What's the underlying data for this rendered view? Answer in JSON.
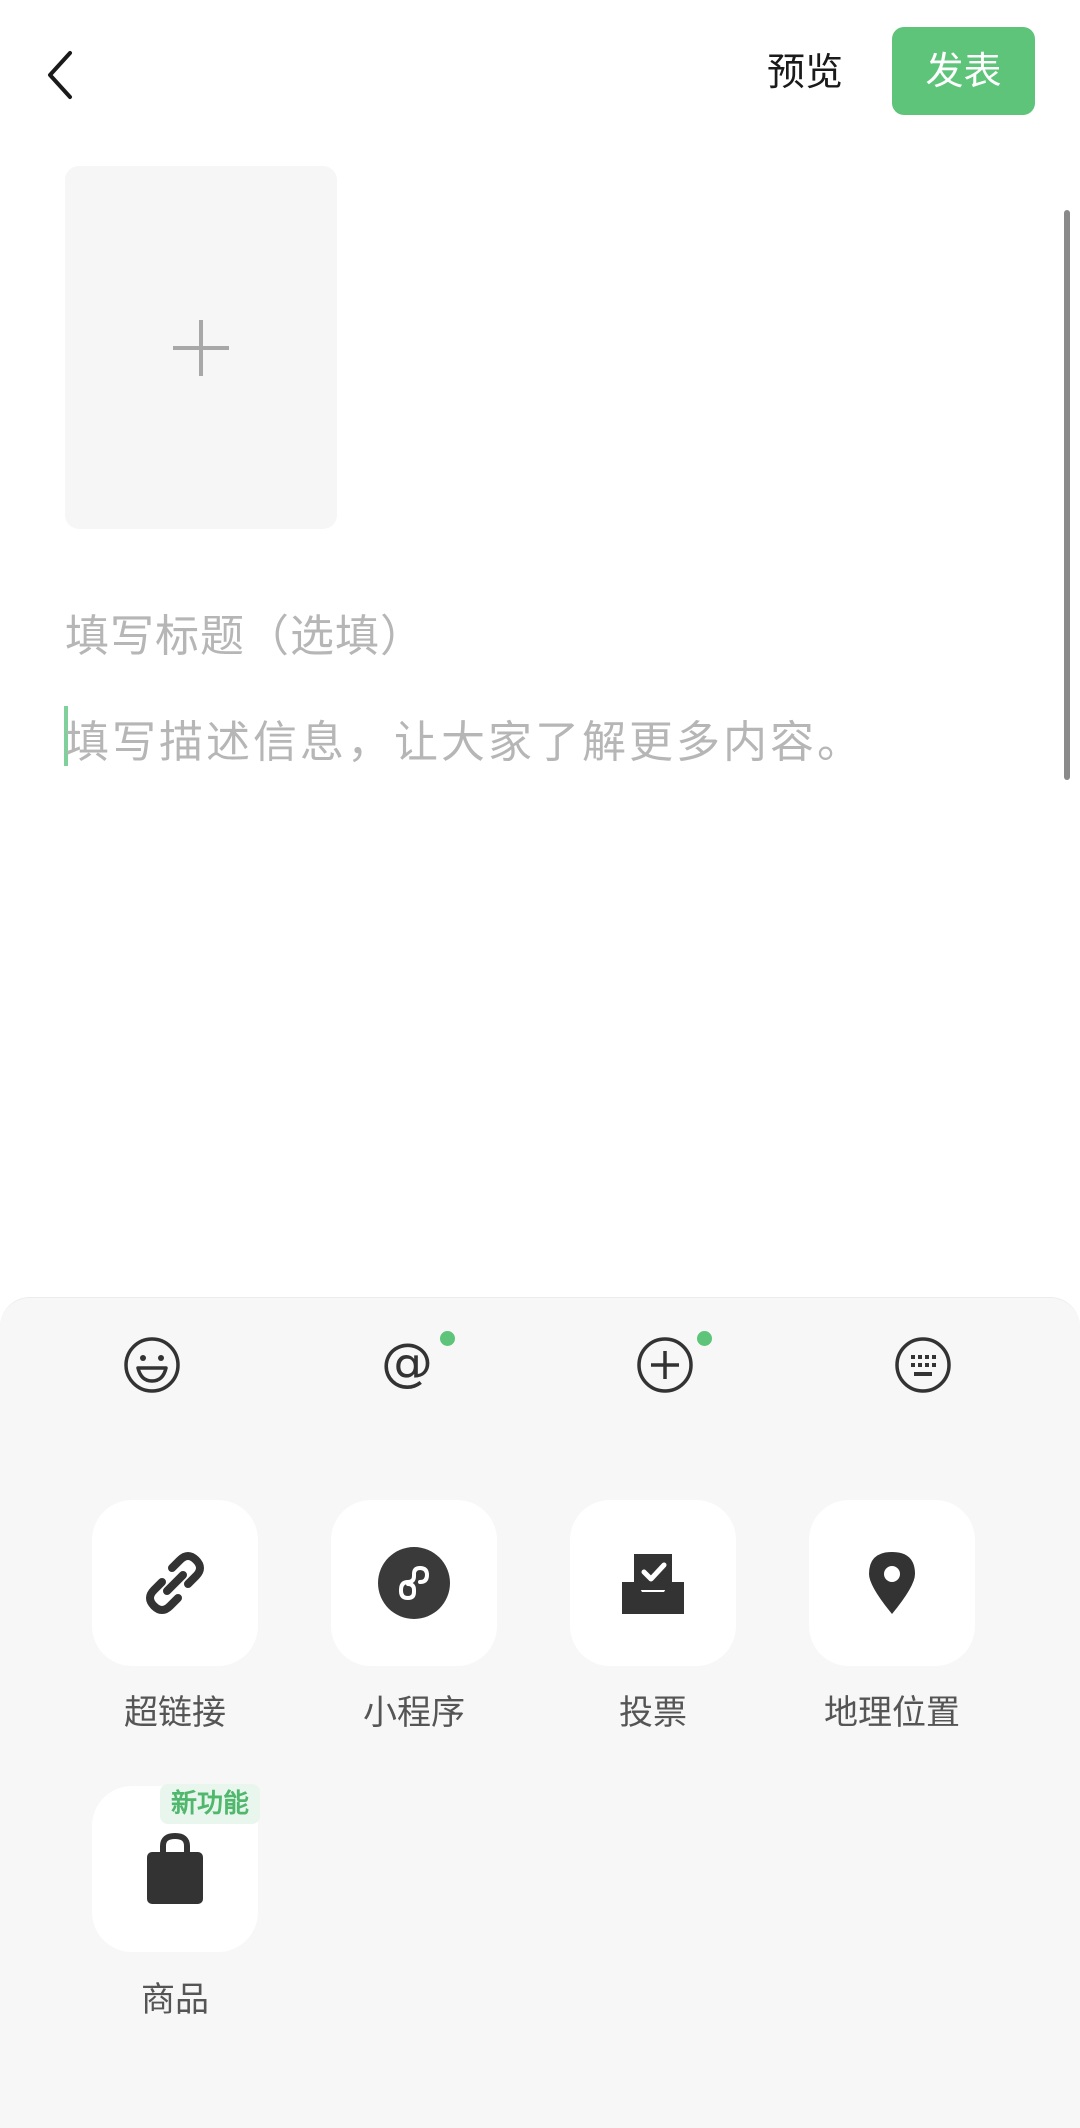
{
  "header": {
    "back_icon": "chevron-left-icon",
    "preview_label": "预览",
    "publish_label": "发表",
    "accent_color": "#5ec47a"
  },
  "editor": {
    "cover_icon": "plus-icon",
    "title_placeholder": "填写标题（选填）",
    "description_placeholder": "填写描述信息，让大家了解更多内容。"
  },
  "toolbar": {
    "items": [
      {
        "icon": "emoji-icon"
      },
      {
        "icon": "at-mention-icon",
        "dot": true
      },
      {
        "icon": "add-circle-icon",
        "dot": true
      },
      {
        "icon": "keyboard-icon"
      }
    ]
  },
  "features": {
    "items": [
      {
        "label": "超链接",
        "icon": "link-icon"
      },
      {
        "label": "小程序",
        "icon": "mini-program-icon"
      },
      {
        "label": "投票",
        "icon": "vote-icon"
      },
      {
        "label": "地理位置",
        "icon": "location-icon"
      },
      {
        "label": "商品",
        "icon": "shopping-bag-icon",
        "badge": "新功能"
      }
    ]
  }
}
